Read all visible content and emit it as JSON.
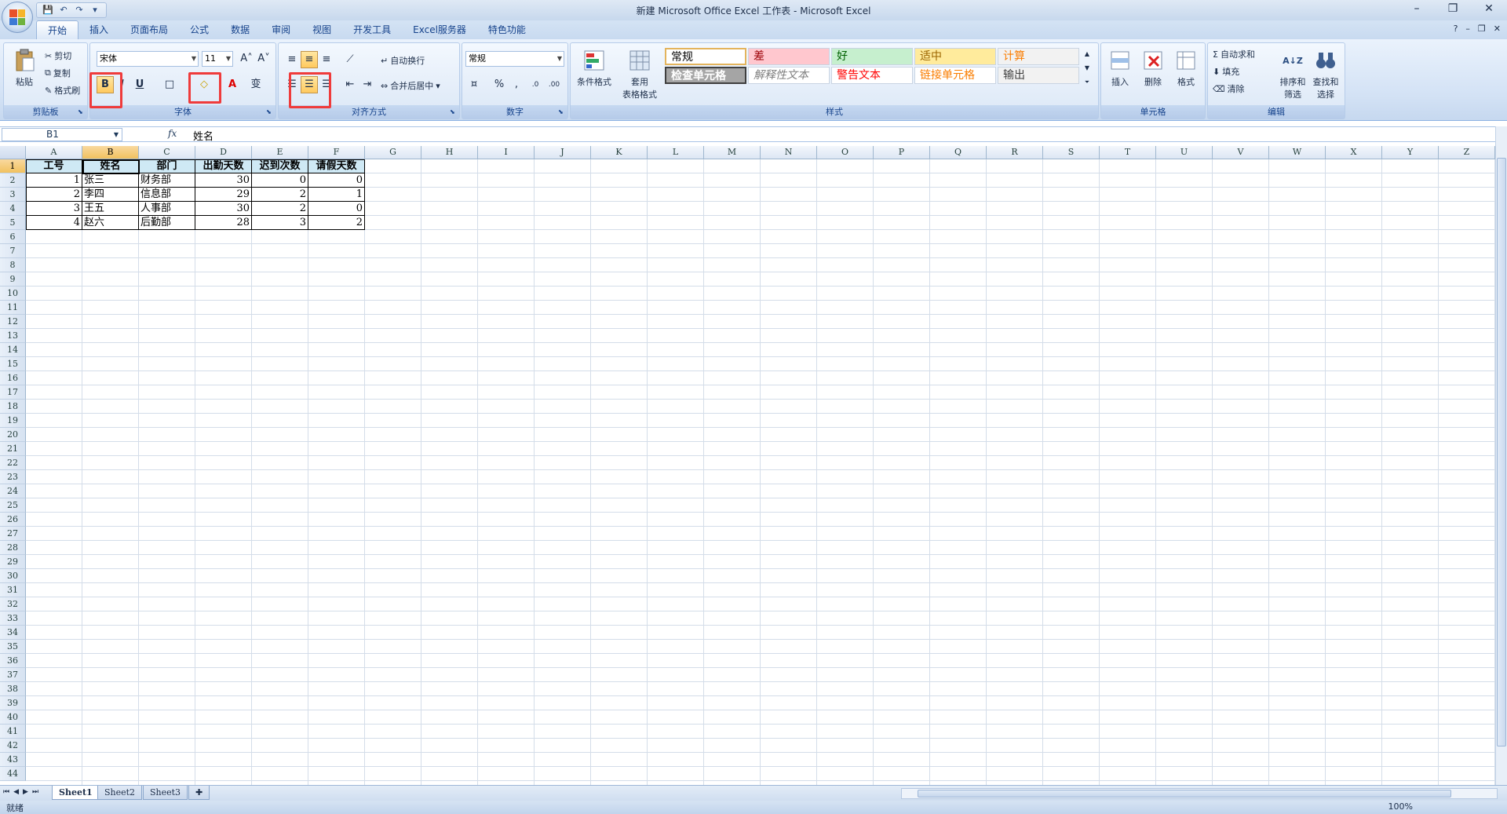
{
  "window": {
    "title": "新建 Microsoft Office Excel 工作表 - Microsoft Excel",
    "min": "–",
    "restore": "❐",
    "close": "✕"
  },
  "qat": {
    "save": "💾",
    "undo": "↶",
    "redo": "↷",
    "customize": "▾"
  },
  "tabs": [
    "开始",
    "插入",
    "页面布局",
    "公式",
    "数据",
    "审阅",
    "视图",
    "开发工具",
    "Excel服务器",
    "特色功能"
  ],
  "tabs_right": {
    "help": "?",
    "min": "–",
    "restore": "❐",
    "close": "✕"
  },
  "ribbon": {
    "clipboard": {
      "label": "剪贴板",
      "paste": "粘贴",
      "cut": "剪切",
      "copy": "复制",
      "format_painter": "格式刷"
    },
    "font": {
      "label": "字体",
      "font_name": "宋体",
      "font_size": "11",
      "grow": "A˄",
      "shrink": "A˅",
      "bold": "B",
      "italic": "I",
      "underline": "U",
      "border": "□",
      "fill": "◇",
      "font_color": "A",
      "phonetic": "变"
    },
    "alignment": {
      "label": "对齐方式",
      "wrap_text": "自动换行",
      "merge_center": "合并后居中"
    },
    "number": {
      "label": "数字",
      "format": "常规",
      "percent": "%",
      "comma": ",",
      "inc_dec": ".0",
      "dec_dec": ".00"
    },
    "styles": {
      "label": "样式",
      "conditional": "条件格式",
      "table": [
        "套用",
        "表格格式"
      ],
      "cells": [
        {
          "text": "常规",
          "bg": "#ffffff",
          "fg": "#000000"
        },
        {
          "text": "差",
          "bg": "#ffc7ce",
          "fg": "#9c0006"
        },
        {
          "text": "好",
          "bg": "#c6efce",
          "fg": "#006100"
        },
        {
          "text": "适中",
          "bg": "#ffeb9c",
          "fg": "#9c6500"
        },
        {
          "text": "计算",
          "bg": "#f2f2f2",
          "fg": "#fa7d00"
        },
        {
          "text": "检查单元格",
          "bg": "#a5a5a5",
          "fg": "#ffffff"
        },
        {
          "text": "解释性文本",
          "bg": "#ffffff",
          "fg": "#7f7f7f"
        },
        {
          "text": "警告文本",
          "bg": "#ffffff",
          "fg": "#ff0000"
        },
        {
          "text": "链接单元格",
          "bg": "#ffffff",
          "fg": "#fa7d00"
        },
        {
          "text": "输出",
          "bg": "#f2f2f2",
          "fg": "#3f3f3f"
        }
      ]
    },
    "cells_group": {
      "label": "单元格",
      "insert": "插入",
      "delete": "删除",
      "format": "格式"
    },
    "editing": {
      "label": "编辑",
      "autosum": "自动求和",
      "fill": "填充",
      "clear": "清除",
      "sort_filter": [
        "排序和",
        "筛选"
      ],
      "find_select": [
        "查找和",
        "选择"
      ]
    }
  },
  "formula_bar": {
    "name_box": "B1",
    "fx": "fx",
    "content": "姓名"
  },
  "columns": [
    "A",
    "B",
    "C",
    "D",
    "E",
    "F",
    "G",
    "H",
    "I",
    "J",
    "K",
    "L",
    "M",
    "N",
    "O",
    "P",
    "Q",
    "R",
    "S",
    "T",
    "U",
    "V",
    "W",
    "X",
    "Y",
    "Z"
  ],
  "rows": 44,
  "table": {
    "headers": [
      "工号",
      "姓名",
      "部门",
      "出勤天数",
      "迟到次数",
      "请假天数"
    ],
    "rows": [
      [
        "1",
        "张三",
        "财务部",
        "30",
        "0",
        "0"
      ],
      [
        "2",
        "李四",
        "信息部",
        "29",
        "2",
        "1"
      ],
      [
        "3",
        "王五",
        "人事部",
        "30",
        "2",
        "0"
      ],
      [
        "4",
        "赵六",
        "后勤部",
        "28",
        "3",
        "2"
      ]
    ]
  },
  "sheets": [
    "Sheet1",
    "Sheet2",
    "Sheet3"
  ],
  "status": {
    "text": "就绪",
    "zoom": "100%"
  }
}
